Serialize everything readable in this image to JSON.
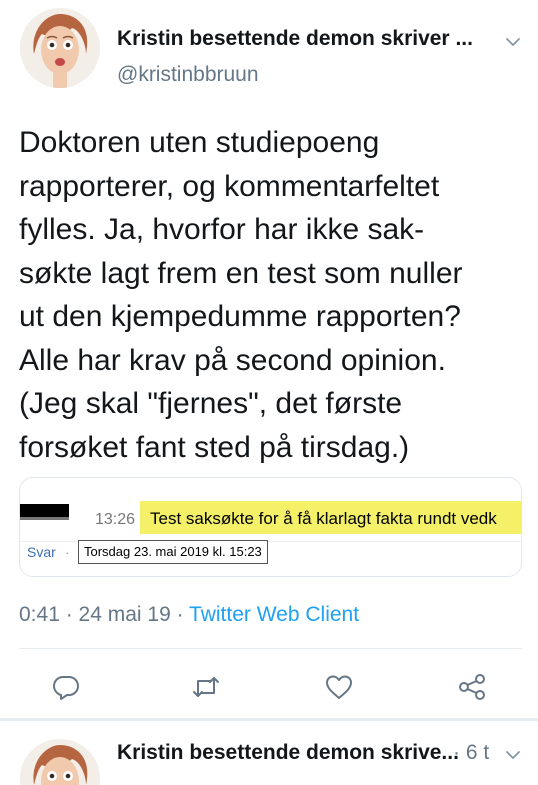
{
  "tweet": {
    "author_name": "Kristin besettende demon skriver ...",
    "author_handle": "@kristinbbruun",
    "text": "Doktoren uten studiepoeng\nrapporterer, og kommentarfeltet\nfylles. Ja, hvorfor har ikke sak-\nsøkte lagt frem en test som nuller\nut den kjempedumme rapporten?\nAlle har krav på second opinion.\n(Jeg skal \"fjernes\", det første\nforsøket fant sted på tirsdag.)",
    "timestamp": "0:41 · 24 mai 19 · ",
    "client": "Twitter Web Client"
  },
  "attached_image": {
    "time": "13:26",
    "highlighted_text": "Test saksøkte for å få klarlagt fakta rundt vedk",
    "reply_label": "Svar",
    "dot": "·",
    "date_tooltip": "Torsdag 23. mai 2019 kl. 15:23",
    "highlight_color": "#f4f067"
  },
  "actions": [
    {
      "name": "reply",
      "icon": "reply-icon"
    },
    {
      "name": "retweet",
      "icon": "retweet-icon"
    },
    {
      "name": "like",
      "icon": "heart-icon"
    },
    {
      "name": "share",
      "icon": "share-icon"
    }
  ],
  "next_tweet": {
    "author_name": "Kristin besettende demon skrive...",
    "time": "· 6 t"
  },
  "colors": {
    "text": "#14171a",
    "secondary": "#657786",
    "link": "#1da1f2",
    "divider": "#e6ecf0"
  }
}
